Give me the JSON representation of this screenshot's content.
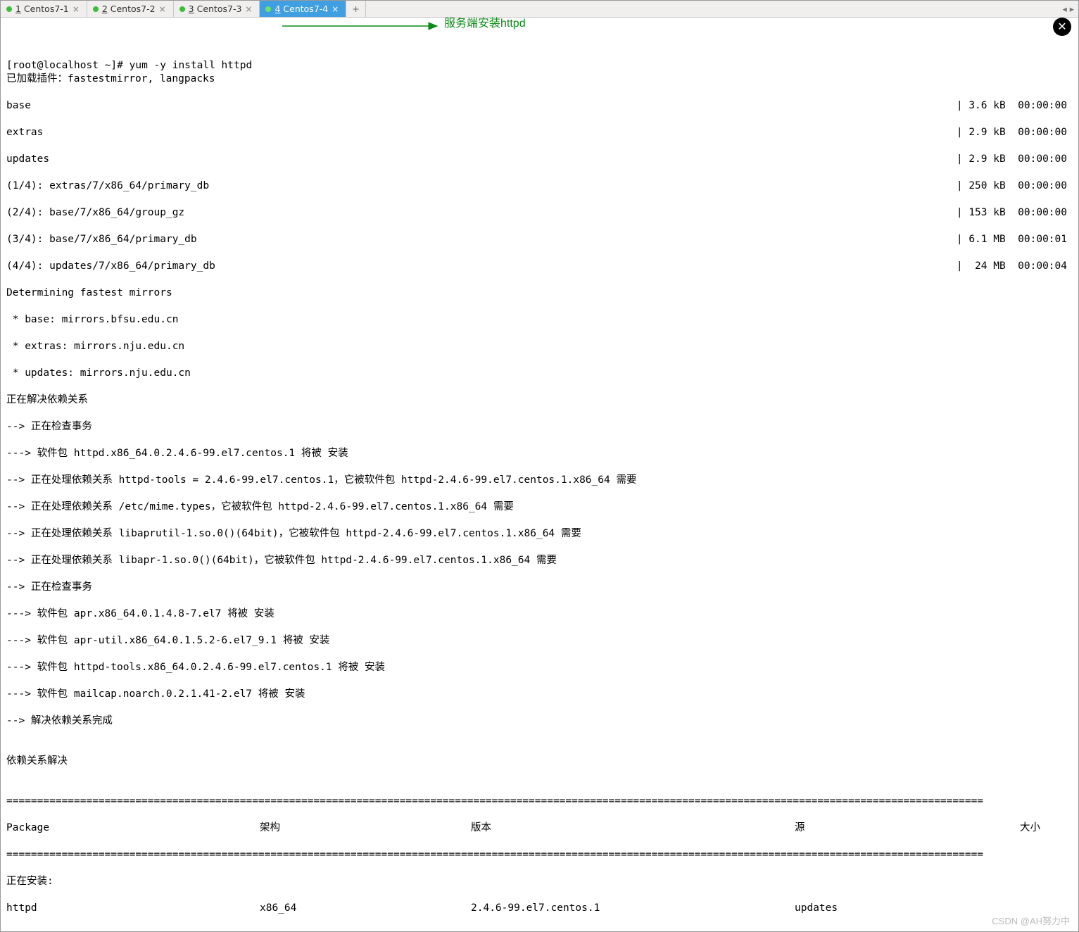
{
  "tabs": [
    {
      "num": "1",
      "label": "Centos7-1",
      "active": false
    },
    {
      "num": "2",
      "label": "Centos7-2",
      "active": false
    },
    {
      "num": "3",
      "label": "Centos7-3",
      "active": false
    },
    {
      "num": "4",
      "label": "Centos7-4",
      "active": true
    }
  ],
  "annotation": "服务端安装httpd",
  "prompt": "[root@localhost ~]# ",
  "command": "yum -y install httpd",
  "plugins_line": "已加载插件：fastestmirror, langpacks",
  "repo_rows": [
    {
      "l": "base",
      "r": "| 3.6 kB  00:00:00"
    },
    {
      "l": "extras",
      "r": "| 2.9 kB  00:00:00"
    },
    {
      "l": "updates",
      "r": "| 2.9 kB  00:00:00"
    },
    {
      "l": "(1/4): extras/7/x86_64/primary_db",
      "r": "| 250 kB  00:00:00"
    },
    {
      "l": "(2/4): base/7/x86_64/group_gz",
      "r": "| 153 kB  00:00:00"
    },
    {
      "l": "(3/4): base/7/x86_64/primary_db",
      "r": "| 6.1 MB  00:00:01"
    },
    {
      "l": "(4/4): updates/7/x86_64/primary_db",
      "r": "|  24 MB  00:00:04"
    }
  ],
  "mirror_block": [
    "Determining fastest mirrors",
    " * base: mirrors.bfsu.edu.cn",
    " * extras: mirrors.nju.edu.cn",
    " * updates: mirrors.nju.edu.cn"
  ],
  "dep_block": [
    "正在解决依赖关系",
    "--> 正在检查事务",
    "---> 软件包 httpd.x86_64.0.2.4.6-99.el7.centos.1 将被 安装",
    "--> 正在处理依赖关系 httpd-tools = 2.4.6-99.el7.centos.1，它被软件包 httpd-2.4.6-99.el7.centos.1.x86_64 需要",
    "--> 正在处理依赖关系 /etc/mime.types，它被软件包 httpd-2.4.6-99.el7.centos.1.x86_64 需要",
    "--> 正在处理依赖关系 libaprutil-1.so.0()(64bit)，它被软件包 httpd-2.4.6-99.el7.centos.1.x86_64 需要",
    "--> 正在处理依赖关系 libapr-1.so.0()(64bit)，它被软件包 httpd-2.4.6-99.el7.centos.1.x86_64 需要",
    "--> 正在检查事务",
    "---> 软件包 apr.x86_64.0.1.4.8-7.el7 将被 安装",
    "---> 软件包 apr-util.x86_64.0.1.5.2-6.el7_9.1 将被 安装",
    "---> 软件包 httpd-tools.x86_64.0.2.4.6-99.el7.centos.1 将被 安装",
    "---> 软件包 mailcap.noarch.0.2.1.41-2.el7 将被 安装",
    "--> 解决依赖关系完成",
    "",
    "依赖关系解决",
    ""
  ],
  "table_header": {
    "package": "Package",
    "arch": "架构",
    "version": "版本",
    "repo": "源",
    "size": "大小"
  },
  "installing_label": "正在安装:",
  "install_row": {
    "package": "httpd",
    "arch": "x86_64",
    "version": "2.4.6-99.el7.centos.1",
    "repo": "updates"
  },
  "watermark": "CSDN @AH努力中",
  "divider": "==============================================================================================================================================================="
}
